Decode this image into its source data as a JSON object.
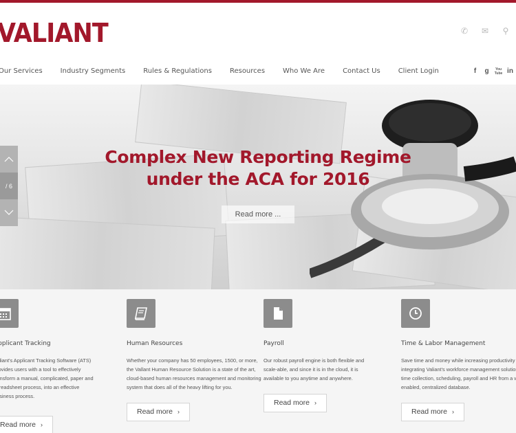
{
  "brand": {
    "logo_text": "VALIANT",
    "accent_color": "#a2182b"
  },
  "header": {
    "contact_icons": [
      "phone-icon",
      "email-icon",
      "search-icon"
    ],
    "nav": [
      "Our Services",
      "Industry Segments",
      "Rules & Regulations",
      "Resources",
      "Who We Are",
      "Contact Us",
      "Client Login"
    ],
    "social": {
      "facebook": "f",
      "google": "g",
      "youtube": "You Tube",
      "linkedin": "in"
    }
  },
  "hero": {
    "title_line1": "Complex New Reporting Regime",
    "title_line2": "under the ACA for 2016",
    "button_label": "Read more ...",
    "slide_counter": "/ 6"
  },
  "features": [
    {
      "icon": "calendar-icon",
      "title": "Applicant Tracking",
      "text": "Valiant's Applicant Tracking Software (ATS) provides users with a tool to effectively transform a manual, complicated, paper and spreadsheet process, into an effective business process.",
      "button": "Read more"
    },
    {
      "icon": "book-icon",
      "title": "Human Resources",
      "text": "Whether your company has 50 employees, 1500, or more, the Vallant Human Resource Solution is a state of the art, cloud-based human resources management and monitoring system that does all of the heavy lifting for you.",
      "button": "Read more"
    },
    {
      "icon": "document-icon",
      "title": "Payroll",
      "text": "Our robust payroll engine is both flexible and scale-able, and since it is in the cloud, it is available to you anytime and anywhere.",
      "button": "Read more"
    },
    {
      "icon": "clock-icon",
      "title": "Time & Labor Management",
      "text": "Save time and money while increasing productivity by integrating Valiant's workforce management solutions for time collection, scheduling, payroll and HR from a web-enabled, centralized database.",
      "button": "Read more"
    }
  ]
}
